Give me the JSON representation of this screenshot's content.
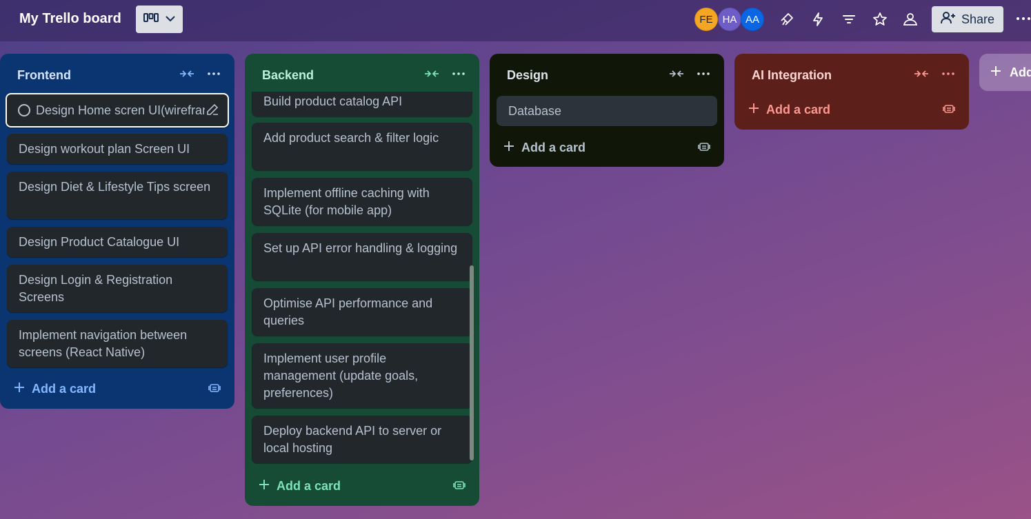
{
  "header": {
    "board_title": "My Trello board",
    "avatars": [
      "FE",
      "HA",
      "AA"
    ],
    "share_label": "Share",
    "icons": [
      "board-view-icon",
      "chevron-down-icon",
      "power-ups-icon",
      "automation-icon",
      "filter-icon",
      "star-icon",
      "visibility-icon",
      "add-member-icon",
      "more-icon"
    ]
  },
  "lists": {
    "frontend": {
      "title": "Frontend",
      "cards": [
        "Design Home scren UI(wirefram",
        "Design workout plan Screen UI",
        "Design Diet & Lifestyle Tips screen",
        "Design Product Catalogue UI",
        "Design Login & Registration Screens",
        "Implement navigation between screens (React Native)"
      ],
      "add_label": "Add a card",
      "color": "#0a3570",
      "accent": "#85b8ff"
    },
    "backend": {
      "title": "Backend",
      "cards": [
        "Build product catalog API",
        "Add product search & filter logic",
        "Implement offline caching with SQLite (for mobile app)",
        "Set up API error handling & logging",
        "Optimise API performance and queries",
        "Implement user profile management (update goals, preferences)",
        "Deploy backend API to server or local hosting"
      ],
      "add_label": "Add a card",
      "color": "#164b35",
      "accent": "#7ee2b8"
    },
    "design": {
      "title": "Design",
      "cards": [
        "Database"
      ],
      "add_label": "Add a card",
      "color": "#111708",
      "accent": "#b6c2cf"
    },
    "ai": {
      "title": "AI Integration",
      "cards": [],
      "add_label": "Add a card",
      "color": "#5d1f1a",
      "accent": "#fd9891"
    }
  },
  "add_list_label": "Add"
}
